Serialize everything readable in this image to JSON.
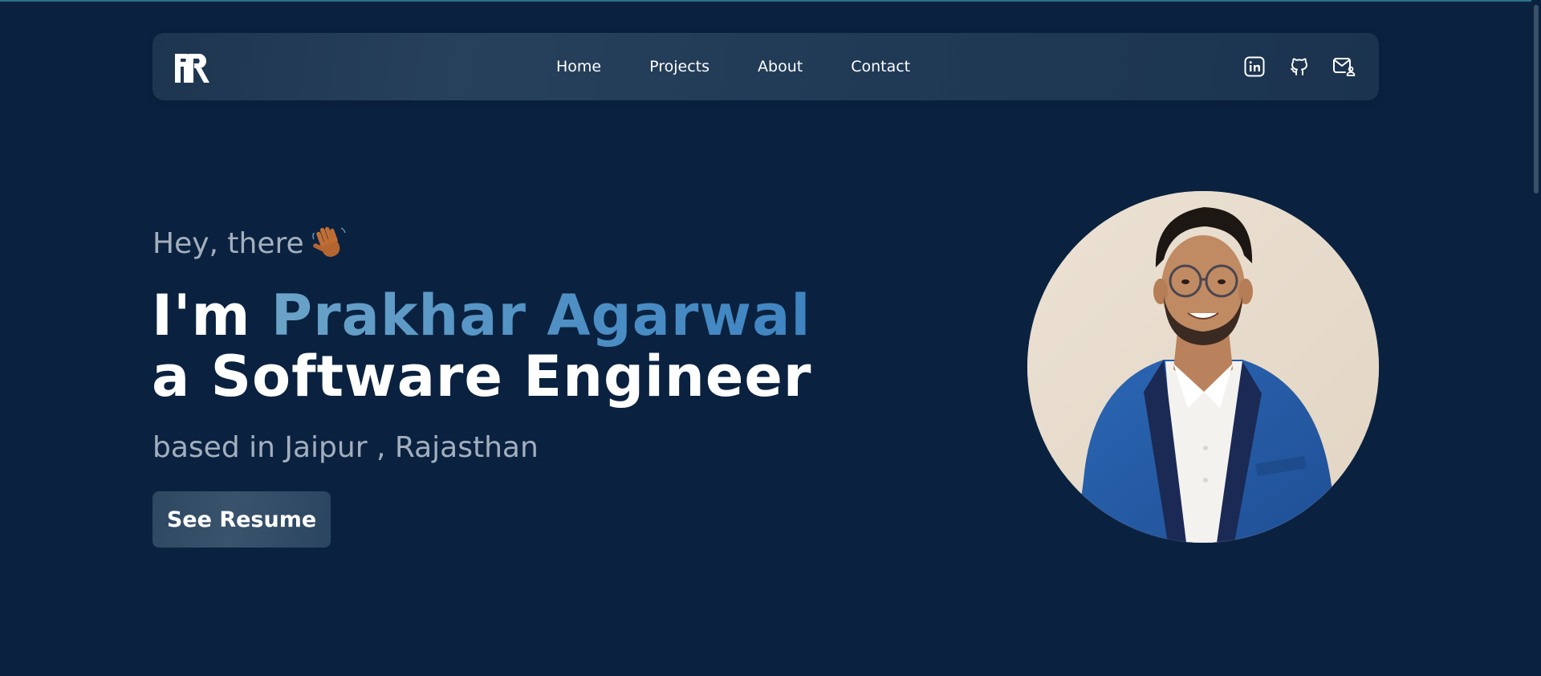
{
  "nav": {
    "logo_alt": "PR",
    "links": [
      "Home",
      "Projects",
      "About",
      "Contact"
    ],
    "social_icons": [
      "linkedin-icon",
      "github-icon",
      "mail-icon"
    ]
  },
  "hero": {
    "greeting": "Hey, there",
    "greeting_emoji": "waving-hand-icon",
    "intro_prefix": "I'm ",
    "name": "Prakhar Agarwal",
    "role": "a Software Engineer",
    "location": "based in Jaipur , Rajasthan",
    "cta_label": "See Resume"
  },
  "colors": {
    "background": "#0a2240",
    "accent": "#4c8ec4",
    "muted_text": "#a3afbd"
  }
}
